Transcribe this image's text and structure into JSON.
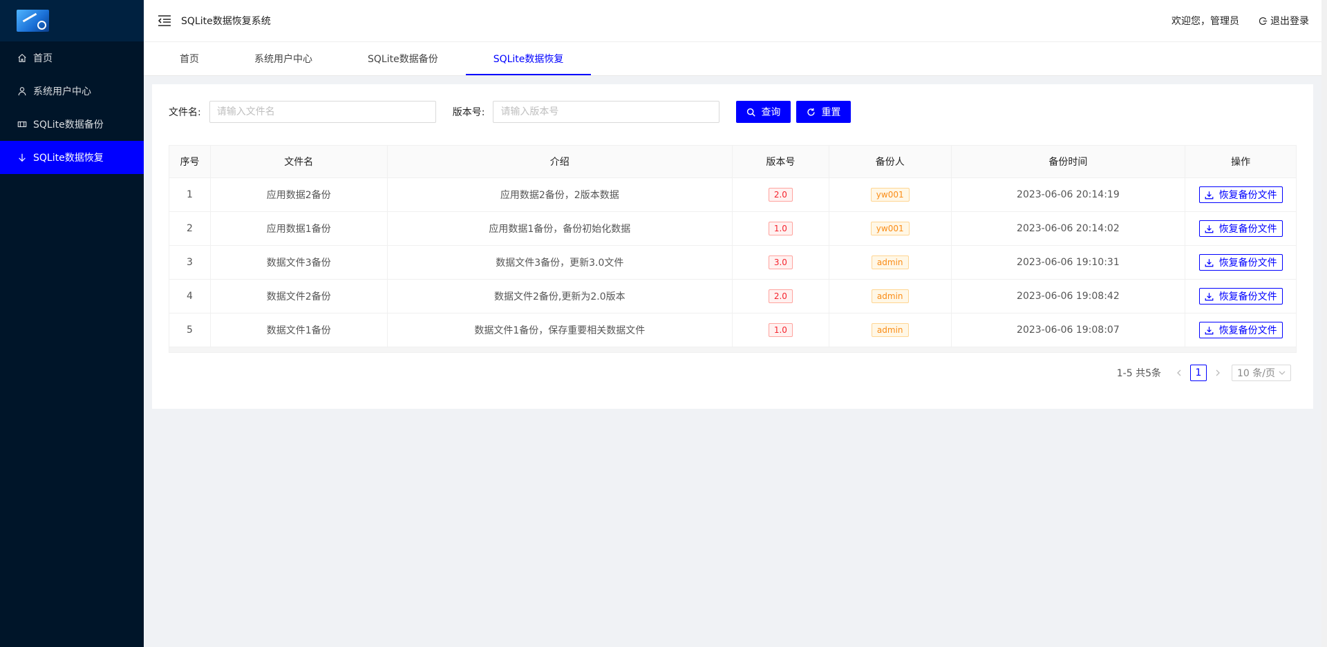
{
  "app": {
    "title": "SQLite数据恢复系统"
  },
  "sidebar": {
    "items": [
      {
        "label": "首页",
        "icon": "home-icon"
      },
      {
        "label": "系统用户中心",
        "icon": "user-icon"
      },
      {
        "label": "SQLite数据备份",
        "icon": "backup-icon"
      },
      {
        "label": "SQLite数据恢复",
        "icon": "arrow-down-icon",
        "active": true
      }
    ]
  },
  "header": {
    "welcome": "欢迎您，管理员",
    "logout": "退出登录"
  },
  "tabs": [
    {
      "label": "首页"
    },
    {
      "label": "系统用户中心"
    },
    {
      "label": "SQLite数据备份"
    },
    {
      "label": "SQLite数据恢复",
      "active": true
    }
  ],
  "search": {
    "filename_label": "文件名:",
    "filename_placeholder": "请输入文件名",
    "version_label": "版本号:",
    "version_placeholder": "请输入版本号",
    "query_button": "查询",
    "reset_button": "重置"
  },
  "table": {
    "columns": [
      "序号",
      "文件名",
      "介绍",
      "版本号",
      "备份人",
      "备份时间",
      "操作"
    ],
    "action_label": "恢复备份文件",
    "rows": [
      {
        "no": "1",
        "filename": "应用数据2备份",
        "intro": "应用数据2备份，2版本数据",
        "version": "2.0",
        "user": "yw001",
        "time": "2023-06-06 20:14:19"
      },
      {
        "no": "2",
        "filename": "应用数据1备份",
        "intro": "应用数据1备份，备份初始化数据",
        "version": "1.0",
        "user": "yw001",
        "time": "2023-06-06 20:14:02"
      },
      {
        "no": "3",
        "filename": "数据文件3备份",
        "intro": "数据文件3备份，更新3.0文件",
        "version": "3.0",
        "user": "admin",
        "time": "2023-06-06 19:10:31"
      },
      {
        "no": "4",
        "filename": "数据文件2备份",
        "intro": "数据文件2备份,更新为2.0版本",
        "version": "2.0",
        "user": "admin",
        "time": "2023-06-06 19:08:42"
      },
      {
        "no": "5",
        "filename": "数据文件1备份",
        "intro": "数据文件1备份，保存重要相关数据文件",
        "version": "1.0",
        "user": "admin",
        "time": "2023-06-06 19:08:07"
      }
    ]
  },
  "pagination": {
    "total_text": "1-5 共5条",
    "current_page": "1",
    "page_size": "10 条/页"
  },
  "colors": {
    "sidebar_bg": "#001529",
    "accent": "#0000ff",
    "tag_version": "#f5222d",
    "tag_user": "#fa8c16"
  }
}
